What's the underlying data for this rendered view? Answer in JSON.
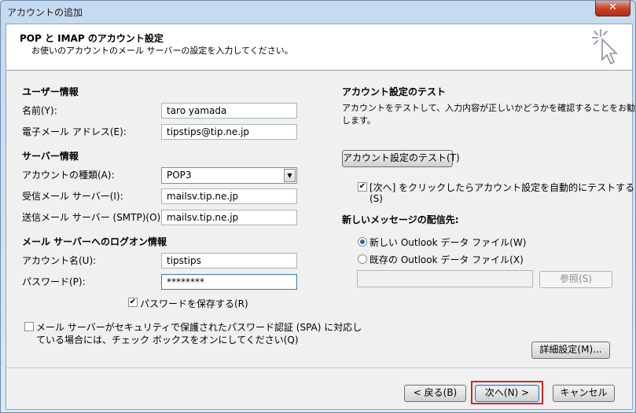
{
  "window": {
    "title": "アカウントの追加",
    "close": "✕"
  },
  "header": {
    "title": "POP と IMAP のアカウント設定",
    "subtitle": "お使いのアカウントのメール サーバーの設定を入力してください。"
  },
  "user_info": {
    "heading": "ユーザー情報",
    "name_label": "名前(Y):",
    "name_value": "taro yamada",
    "email_label": "電子メール アドレス(E):",
    "email_value": "tipstips@tip.ne.jp"
  },
  "server_info": {
    "heading": "サーバー情報",
    "account_type_label": "アカウントの種類(A):",
    "account_type_value": "POP3",
    "incoming_label": "受信メール サーバー(I):",
    "incoming_value": "mailsv.tip.ne.jp",
    "outgoing_label": "送信メール サーバー (SMTP)(O):",
    "outgoing_value": "mailsv.tip.ne.jp"
  },
  "logon_info": {
    "heading": "メール サーバーへのログオン情報",
    "account_name_label": "アカウント名(U):",
    "account_name_value": "tipstips",
    "password_label": "パスワード(P):",
    "password_value": "********",
    "save_password_label": "パスワードを保存する(R)",
    "spa_label_line1": "メール サーバーがセキュリティで保護されたパスワード認証 (SPA) に対応し",
    "spa_label_line2": "ている場合には、チェック ボックスをオンにしてください(Q)"
  },
  "test": {
    "heading": "アカウント設定のテスト",
    "desc_line1": "アカウントをテストして、入力内容が正しいかどうかを確認することをお勧め",
    "desc_line2": "します。",
    "test_button": "アカウント設定のテスト(T)",
    "auto_test_line1": "[次へ] をクリックしたらアカウント設定を自動的にテストする",
    "auto_test_line2": "(S)"
  },
  "delivery": {
    "heading": "新しいメッセージの配信先:",
    "new_file_label": "新しい Outlook データ ファイル(W)",
    "existing_file_label": "既存の Outlook データ ファイル(X)",
    "browse_button": "参照(S)"
  },
  "buttons": {
    "advanced": "詳細設定(M)...",
    "back": "< 戻る(B)",
    "next": "次へ(N) >",
    "cancel": "キャンセル"
  }
}
